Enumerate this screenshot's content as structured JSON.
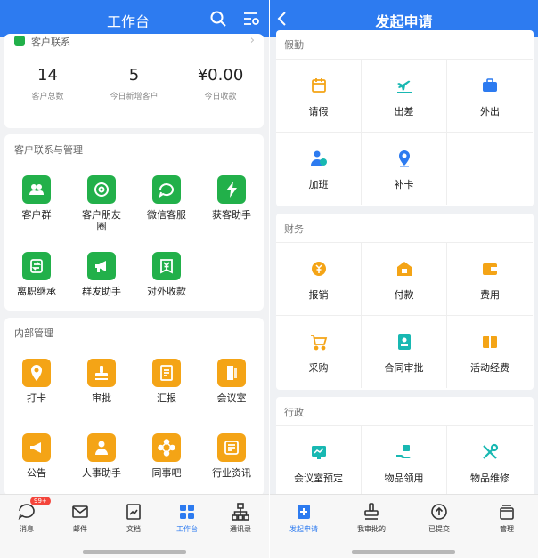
{
  "colors": {
    "primary": "#2d7bf0",
    "green": "#22b04a",
    "orange": "#f4a416",
    "teal": "#18b8b2",
    "badge": "#f4453b"
  },
  "left": {
    "header": {
      "title": "工作台",
      "icons": [
        "search-icon",
        "filter-settings-icon"
      ]
    },
    "customer_card": {
      "title": "客户联系",
      "stats": [
        {
          "value": "14",
          "label": "客户总数"
        },
        {
          "value": "5",
          "label": "今日新增客户"
        },
        {
          "value": "¥0.00",
          "label": "今日收款"
        }
      ]
    },
    "customer_mgmt": {
      "title": "客户联系与管理",
      "apps": [
        {
          "name": "客户群",
          "icon": "group-icon"
        },
        {
          "name": "客户朋友圈",
          "icon": "moments-icon"
        },
        {
          "name": "微信客服",
          "icon": "chat-service-icon"
        },
        {
          "name": "获客助手",
          "icon": "lightning-icon"
        },
        {
          "name": "离职继承",
          "icon": "transfer-icon"
        },
        {
          "name": "群发助手",
          "icon": "megaphone-icon"
        },
        {
          "name": "对外收款",
          "icon": "yuan-icon"
        }
      ]
    },
    "internal_mgmt": {
      "title": "内部管理",
      "apps": [
        {
          "name": "打卡",
          "icon": "location-pin-icon"
        },
        {
          "name": "审批",
          "icon": "stamp-icon"
        },
        {
          "name": "汇报",
          "icon": "report-icon"
        },
        {
          "name": "会议室",
          "icon": "door-icon"
        },
        {
          "name": "公告",
          "icon": "announcement-icon"
        },
        {
          "name": "人事助手",
          "icon": "person-icon"
        },
        {
          "name": "同事吧",
          "icon": "network-icon"
        },
        {
          "name": "行业资讯",
          "icon": "news-icon"
        }
      ]
    },
    "nav": [
      {
        "label": "消息",
        "icon": "message-icon",
        "badge": "99+"
      },
      {
        "label": "邮件",
        "icon": "mail-icon"
      },
      {
        "label": "文档",
        "icon": "document-icon"
      },
      {
        "label": "工作台",
        "icon": "workbench-icon",
        "active": true
      },
      {
        "label": "通讯录",
        "icon": "contacts-icon"
      }
    ]
  },
  "right": {
    "header": {
      "title": "发起申请",
      "back_icon": "chevron-left-icon"
    },
    "sections": [
      {
        "title": "假勤",
        "items": [
          {
            "name": "请假",
            "icon": "calendar-icon"
          },
          {
            "name": "出差",
            "icon": "plane-icon"
          },
          {
            "name": "外出",
            "icon": "briefcase-icon"
          },
          {
            "name": "加班",
            "icon": "overtime-icon"
          },
          {
            "name": "补卡",
            "icon": "location-pin-icon"
          }
        ]
      },
      {
        "title": "财务",
        "items": [
          {
            "name": "报销",
            "icon": "yuan-coin-icon"
          },
          {
            "name": "付款",
            "icon": "payment-icon"
          },
          {
            "name": "费用",
            "icon": "wallet-icon"
          },
          {
            "name": "采购",
            "icon": "cart-icon"
          },
          {
            "name": "合同审批",
            "icon": "contract-icon"
          },
          {
            "name": "活动经费",
            "icon": "gift-box-icon"
          }
        ]
      },
      {
        "title": "行政",
        "items": [
          {
            "name": "会议室预定",
            "icon": "meeting-screen-icon"
          },
          {
            "name": "物品领用",
            "icon": "hand-item-icon"
          },
          {
            "name": "物品维修",
            "icon": "tools-icon"
          }
        ]
      }
    ],
    "nav": [
      {
        "label": "发起申请",
        "icon": "apply-icon",
        "active": true
      },
      {
        "label": "我审批的",
        "icon": "stamp-icon"
      },
      {
        "label": "已提交",
        "icon": "upload-icon"
      },
      {
        "label": "管理",
        "icon": "manage-icon"
      }
    ]
  }
}
